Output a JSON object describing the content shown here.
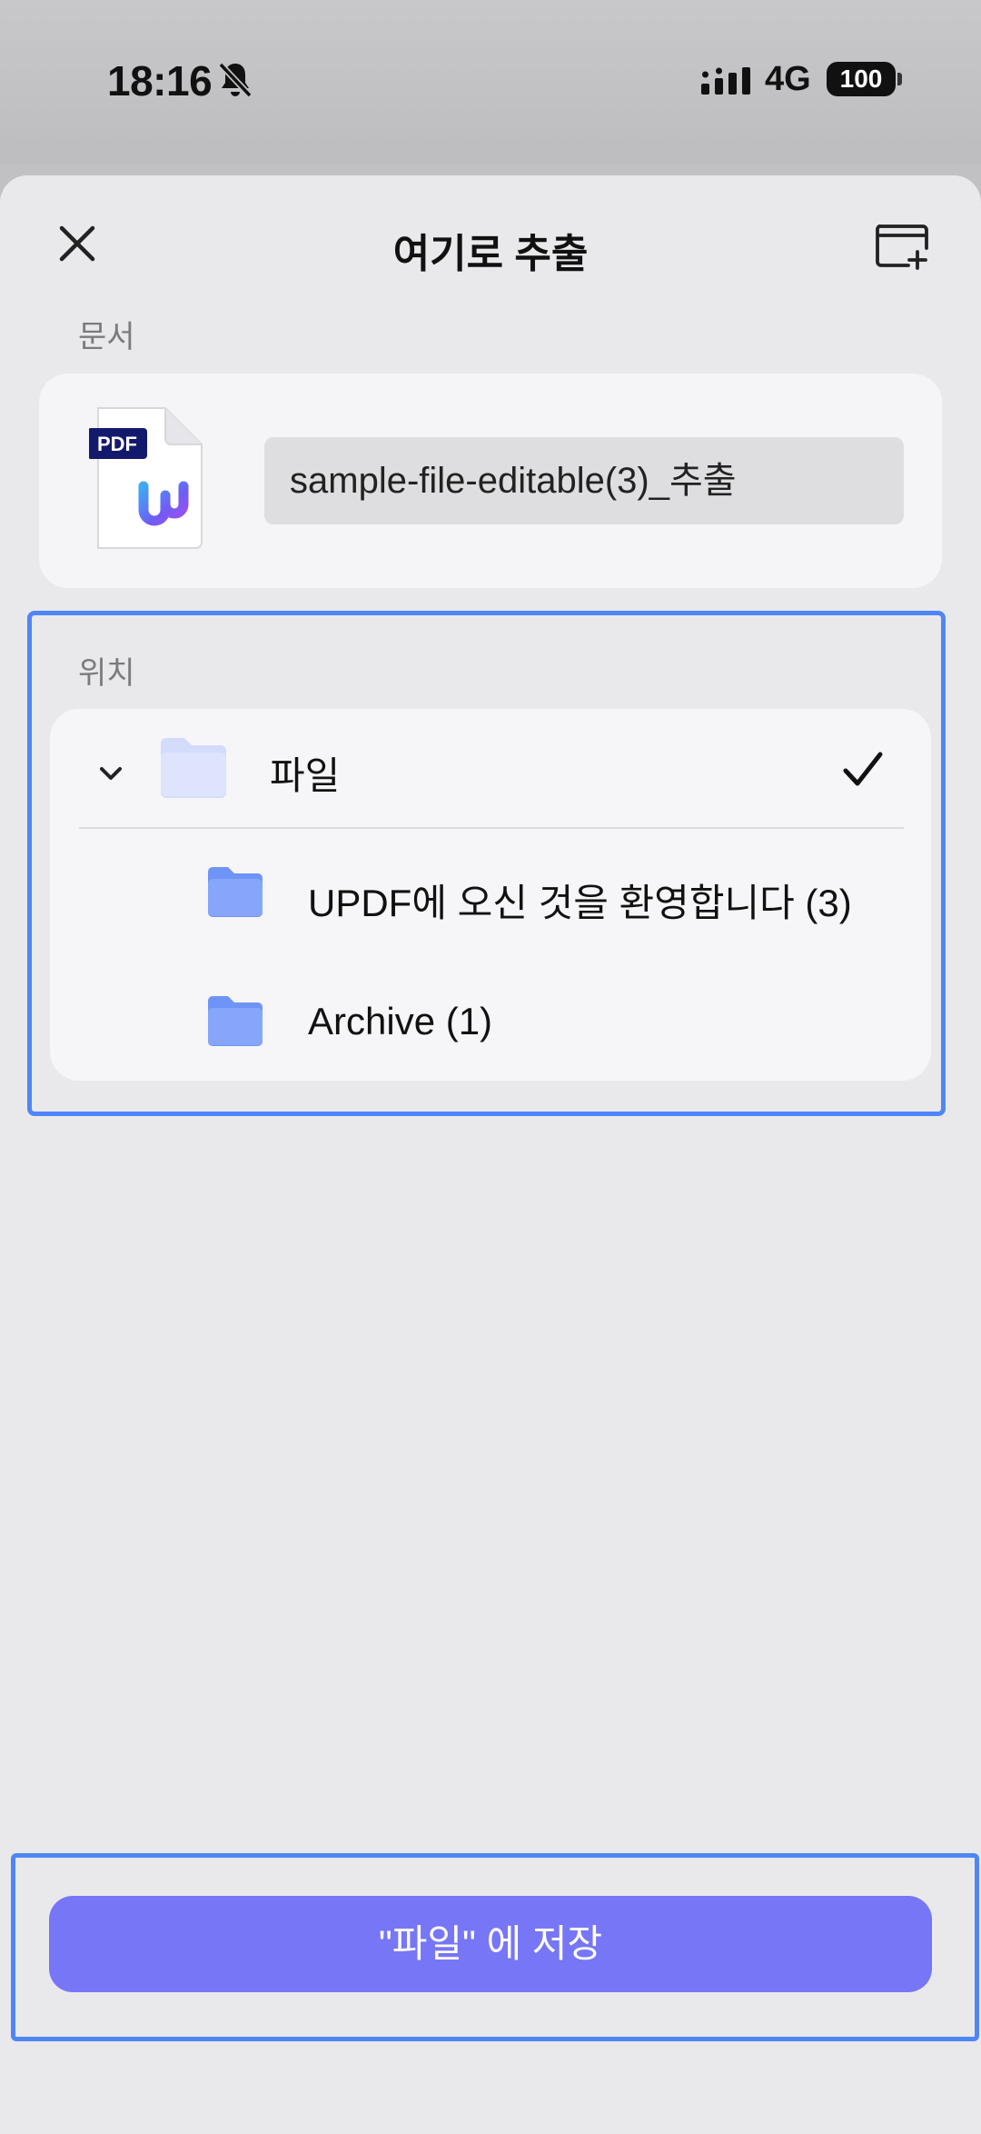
{
  "status_bar": {
    "time": "18:16",
    "silent_icon": "bell-slash-icon",
    "signal_icon": "cellular-signal-icon",
    "network": "4G",
    "battery": "100"
  },
  "sheet": {
    "title": "여기로 추출",
    "close_icon": "close-icon",
    "new_folder_icon": "new-folder-icon"
  },
  "document": {
    "section_label": "문서",
    "file_icon": "pdf-file-icon",
    "pdf_badge": "PDF",
    "file_name": "sample-file-editable(3)_추출"
  },
  "location": {
    "section_label": "위치",
    "root": {
      "label": "파일",
      "expanded": true,
      "selected": true
    },
    "children": [
      {
        "label": "UPDF에 오신 것을 환영합니다 (3)"
      },
      {
        "label": "Archive (1)"
      }
    ]
  },
  "save_button": {
    "label": "\"파일\" 에 저장"
  },
  "colors": {
    "accent": "#7676f7",
    "highlight_outline": "#4f86f7",
    "folder": "#7fa2fb"
  }
}
